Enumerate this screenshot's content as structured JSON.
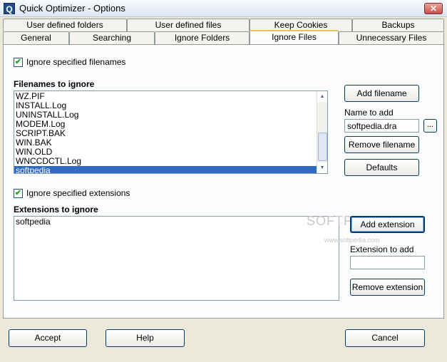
{
  "window": {
    "title": "Quick Optimizer - Options",
    "close_glyph": "✕",
    "app_icon_glyph": "Q"
  },
  "tabs_row1": [
    "User defined folders",
    "User defined files",
    "Keep Cookies",
    "Backups"
  ],
  "tabs_row2": [
    "General",
    "Searching",
    "Ignore Folders",
    "Ignore Files",
    "Unnecessary Files"
  ],
  "active_tab": "Ignore Files",
  "ignore_files": {
    "checkbox_label": "Ignore specified filenames",
    "checked": true,
    "list_title": "Filenames to ignore",
    "items": [
      "WZ.PIF",
      "INSTALL.Log",
      "UNINSTALL.Log",
      "MODEM.Log",
      "SCRIPT.BAK",
      "WIN.BAK",
      "WIN.OLD",
      "WNCCDCTL.Log",
      "softpedia"
    ],
    "selected_item": "softpedia",
    "add_button": "Add filename",
    "name_label": "Name to add",
    "name_value": "softpedia.dra",
    "browse_button": "...",
    "remove_button": "Remove filename",
    "defaults_button": "Defaults"
  },
  "ignore_extensions": {
    "checkbox_label": "Ignore specified extensions",
    "checked": true,
    "list_title": "Extensions to ignore",
    "items": [
      "softpedia"
    ],
    "add_button": "Add extension",
    "ext_label": "Extension to add",
    "ext_value": "",
    "remove_button": "Remove extension"
  },
  "watermark": {
    "text": "SOFTPEDIA",
    "url": "www.softpedia.com"
  },
  "footer": {
    "accept": "Accept",
    "help": "Help",
    "cancel": "Cancel"
  }
}
